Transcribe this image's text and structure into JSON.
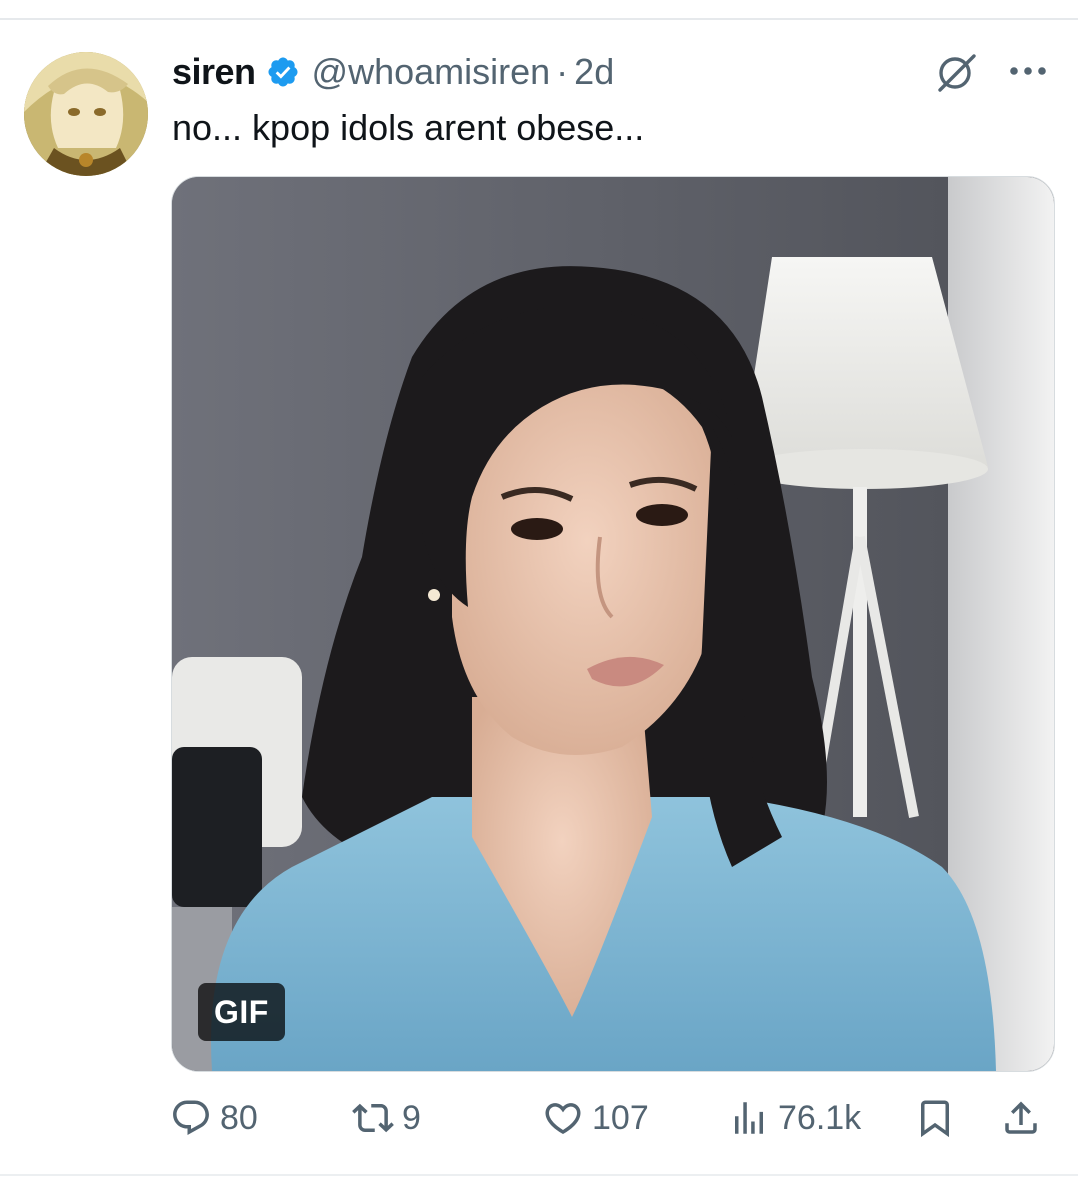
{
  "tweet": {
    "display_name": "siren",
    "verified": true,
    "handle": "@whoamisiren",
    "separator": "·",
    "time": "2d",
    "text": "no... kpop idols arent obese...",
    "media": {
      "badge": "GIF",
      "description_icon": "photo-media"
    }
  },
  "actions": {
    "reply_count": "80",
    "retweet_count": "9",
    "like_count": "107",
    "view_count": "76.1k"
  },
  "colors": {
    "text_primary": "#0f1419",
    "text_secondary": "#536471",
    "verified_blue": "#1d9bf0",
    "divider": "#e6e9ec"
  },
  "icons": {
    "verified": "verified-badge-icon",
    "grok": "grok-icon",
    "more": "more-dots-icon",
    "reply": "reply-bubble-icon",
    "retweet": "retweet-arrows-icon",
    "like": "heart-icon",
    "views": "bar-chart-icon",
    "bookmark": "bookmark-icon",
    "share": "share-upload-icon"
  }
}
